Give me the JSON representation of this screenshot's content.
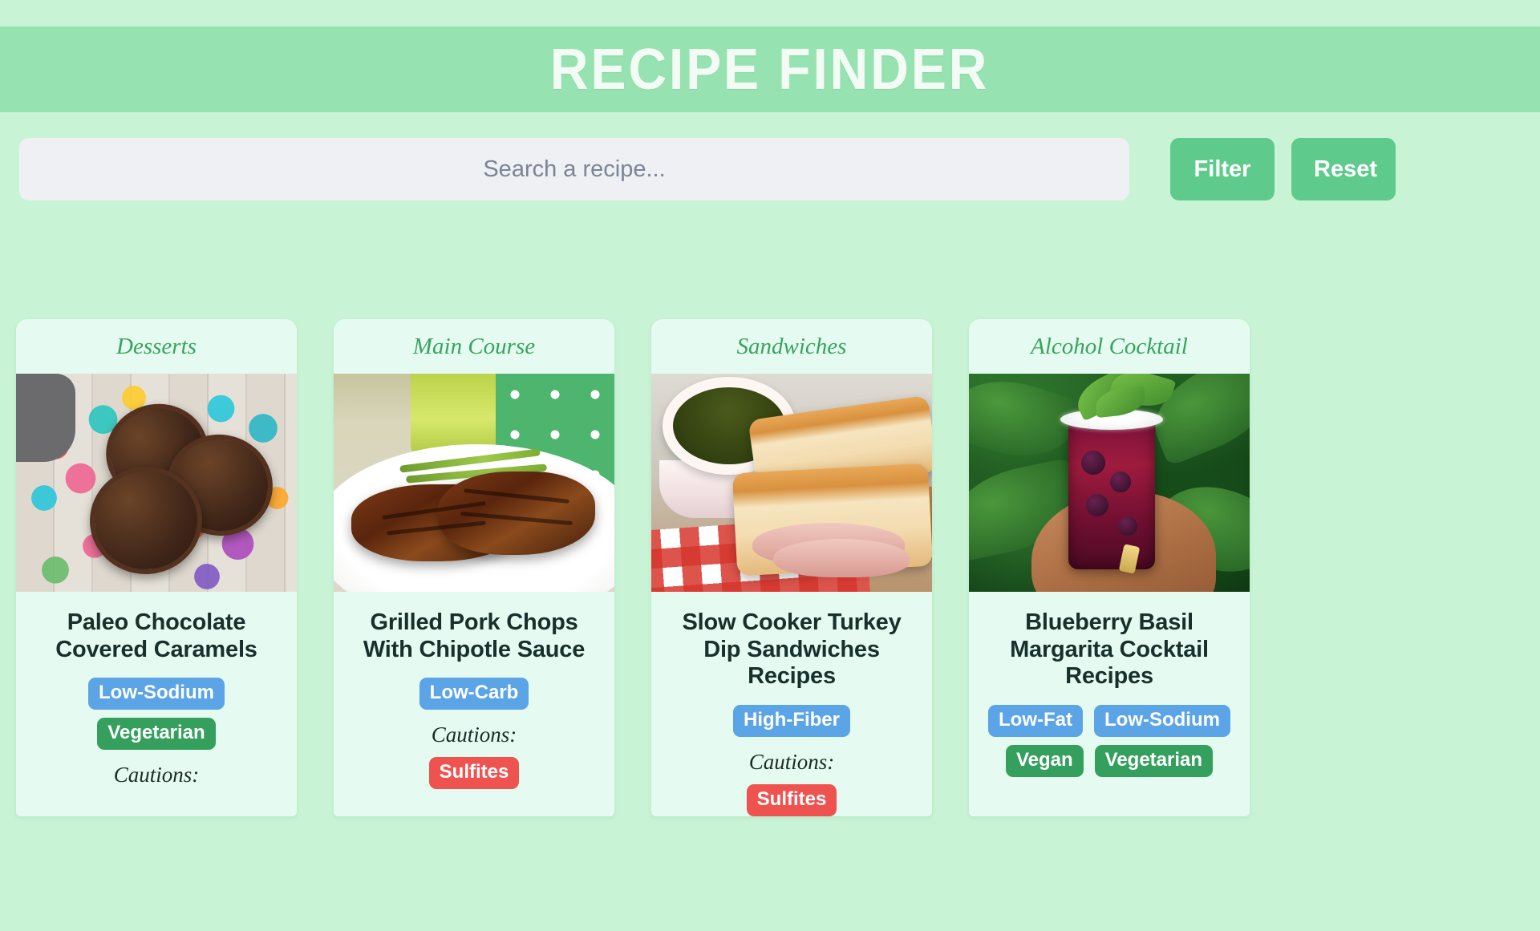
{
  "app": {
    "title": "RECIPE FINDER",
    "banner_color": "#97e2b1",
    "page_background": "#c8f3d4"
  },
  "search": {
    "value": "",
    "placeholder": "Search a recipe...",
    "filter_label": "Filter",
    "reset_label": "Reset",
    "button_color": "#5ecb8d"
  },
  "labels": {
    "cautions": "Cautions:"
  },
  "colors": {
    "tag_blue": "#5ba4e5",
    "tag_green": "#35a05e",
    "tag_red": "#ef5350",
    "card_background": "#e5fbf2",
    "category_text": "#38a35c",
    "title_text": "#17302c"
  },
  "cards": [
    {
      "category": "Desserts",
      "title": "Paleo Chocolate Covered Caramels",
      "image_alt": "chocolate-cups-on-confetti-wood",
      "health_tags": [
        {
          "label": "Low-Sodium",
          "color": "blue"
        },
        {
          "label": "Vegetarian",
          "color": "green"
        }
      ],
      "cautions": []
    },
    {
      "category": "Main Course",
      "title": "Grilled Pork Chops With Chipotle Sauce",
      "image_alt": "grilled-pork-chop-with-asparagus",
      "health_tags": [
        {
          "label": "Low-Carb",
          "color": "blue"
        }
      ],
      "cautions": [
        {
          "label": "Sulfites",
          "color": "red"
        }
      ]
    },
    {
      "category": "Sandwiches",
      "title": "Slow Cooker Turkey Dip Sandwiches Recipes",
      "image_alt": "turkey-sandwich-with-au-jus-bowl",
      "health_tags": [
        {
          "label": "High-Fiber",
          "color": "blue"
        }
      ],
      "cautions": [
        {
          "label": "Sulfites",
          "color": "red"
        }
      ]
    },
    {
      "category": "Alcohol Cocktail",
      "title": "Blueberry Basil Margarita Cocktail Recipes",
      "image_alt": "blueberry-basil-margarita-in-hand",
      "health_tags": [
        {
          "label": "Low-Fat",
          "color": "blue"
        },
        {
          "label": "Low-Sodium",
          "color": "blue"
        },
        {
          "label": "Vegan",
          "color": "green"
        },
        {
          "label": "Vegetarian",
          "color": "green"
        }
      ],
      "cautions": []
    }
  ]
}
